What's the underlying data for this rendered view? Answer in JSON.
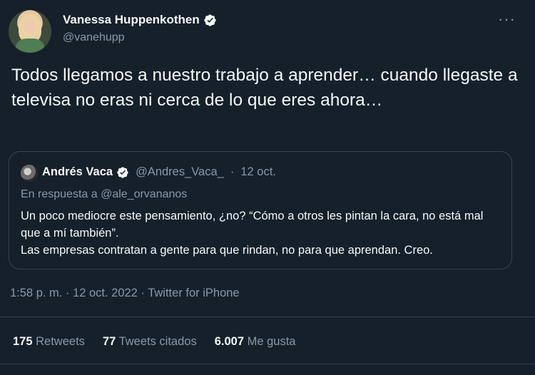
{
  "author": {
    "name": "Vanessa Huppenkothen",
    "handle": "@vanehupp",
    "verified_icon": "verified-badge-icon"
  },
  "more_icon": "more-icon",
  "more_glyph": "···",
  "tweet": {
    "text": "Todos llegamos a nuestro trabajo a aprender… cuando llegaste a televisa no eras ni cerca de lo que eres ahora…"
  },
  "quoted": {
    "name": "Andrés Vaca",
    "handle": "@Andres_Vaca_",
    "separator": "·",
    "date": "12 oct.",
    "reply_to": "En respuesta a @ale_orvananos",
    "line1": "Un poco mediocre este pensamiento, ¿no? “Cómo a otros les pintan la cara, no está mal que a mí también”.",
    "line2": "Las empresas contratan a gente para que rindan, no para que aprendan. Creo."
  },
  "meta": {
    "text": "1:58 p. m. · 12 oct. 2022 · Twitter for iPhone"
  },
  "stats": {
    "retweets_count": "175",
    "retweets_label": "Retweets",
    "quotes_count": "77",
    "quotes_label": "Tweets citados",
    "likes_count": "6.007",
    "likes_label": "Me gusta"
  },
  "colors": {
    "background": "#15202b",
    "text": "#f7f9f9",
    "secondary": "#8b98a5",
    "border": "#38444d",
    "verified": "#1d9bf0"
  }
}
